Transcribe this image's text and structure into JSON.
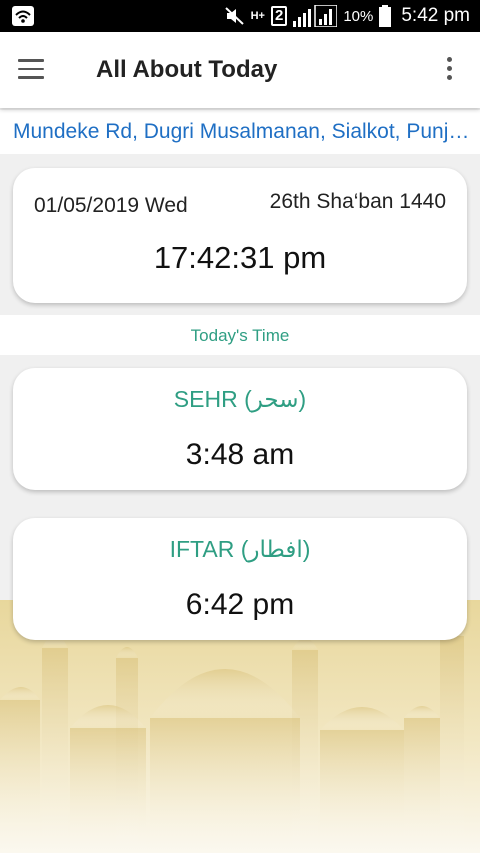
{
  "status_bar": {
    "network_type": "H+",
    "sim_slot": "2",
    "battery_percent": "10%",
    "time": "5:42 pm",
    "icons": [
      "wifi-icon",
      "mute-icon",
      "signal-icon",
      "battery-icon"
    ]
  },
  "app_bar": {
    "title": "All About Today",
    "icons": [
      "menu-icon",
      "more-vert-icon"
    ]
  },
  "location": {
    "text": "Mundeke Rd, Dugri Musalmanan, Sialkot, Punjab, Pakistan"
  },
  "date_card": {
    "gregorian": "01/05/2019 Wed",
    "hijri": "26th Sha‘ban 1440",
    "current_time": "17:42:31 pm"
  },
  "section": {
    "label": "Today's Time"
  },
  "sehr": {
    "name": "SEHR (سحر)",
    "time": "3:48 am"
  },
  "iftar": {
    "name": "IFTAR (افطار)",
    "time": "6:42 pm"
  },
  "colors": {
    "accent": "#2f9e83",
    "location_link": "#1f6fc4",
    "background_art": "#e6d59a"
  }
}
